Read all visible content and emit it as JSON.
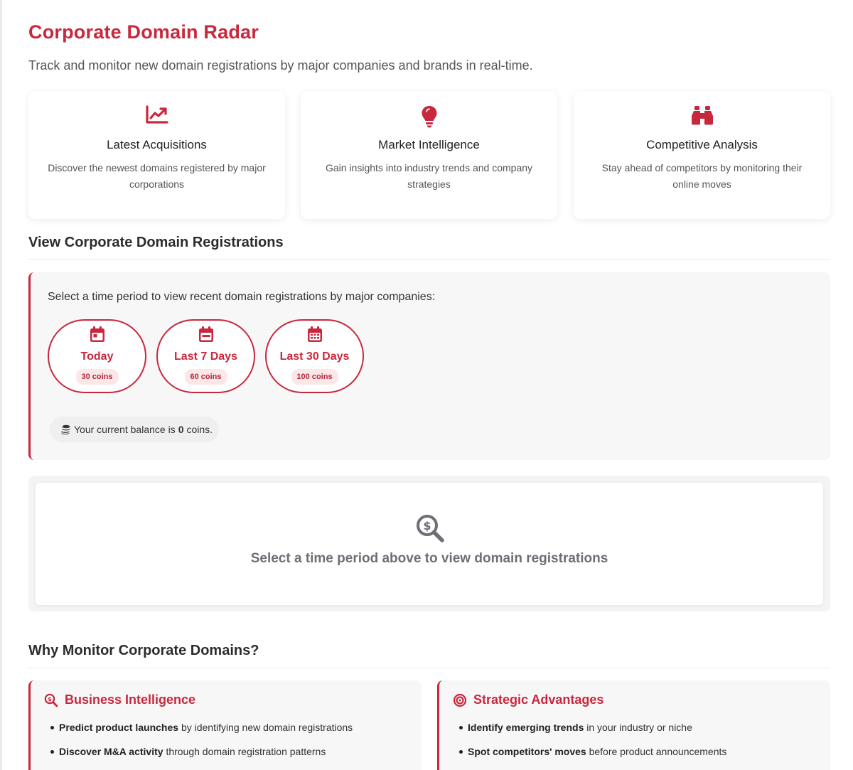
{
  "header": {
    "title": "Corporate Domain Radar",
    "subtitle": "Track and monitor new domain registrations by major companies and brands in real-time."
  },
  "features": [
    {
      "icon": "chart-line-icon",
      "title": "Latest Acquisitions",
      "description": "Discover the newest domains registered by major corporations"
    },
    {
      "icon": "lightbulb-icon",
      "title": "Market Intelligence",
      "description": "Gain insights into industry trends and company strategies"
    },
    {
      "icon": "binoculars-icon",
      "title": "Competitive Analysis",
      "description": "Stay ahead of competitors by monitoring their online moves"
    }
  ],
  "view_section": {
    "heading": "View Corporate Domain Registrations",
    "prompt": "Select a time period to view recent domain registrations by major companies:",
    "periods": [
      {
        "label": "Today",
        "cost": "30 coins",
        "icon": "calendar-day-icon"
      },
      {
        "label": "Last 7 Days",
        "cost": "60 coins",
        "icon": "calendar-week-icon"
      },
      {
        "label": "Last 30 Days",
        "cost": "100 coins",
        "icon": "calendar-month-icon"
      }
    ],
    "balance": {
      "prefix": "Your current balance is",
      "amount": "0",
      "suffix": "coins.",
      "icon": "coins-icon"
    }
  },
  "results": {
    "icon": "search-dollar-icon",
    "empty_message": "Select a time period above to view domain registrations"
  },
  "why_section": {
    "heading": "Why Monitor Corporate Domains?",
    "cards": [
      {
        "icon": "search-icon",
        "title": "Business Intelligence",
        "items": [
          {
            "bold": "Predict product launches",
            "rest": "by identifying new domain registrations"
          },
          {
            "bold": "Discover M&A activity",
            "rest": "through domain registration patterns"
          }
        ]
      },
      {
        "icon": "bullseye-icon",
        "title": "Strategic Advantages",
        "items": [
          {
            "bold": "Identify emerging trends",
            "rest": "in your industry or niche"
          },
          {
            "bold": "Spot competitors' moves",
            "rest": "before product announcements"
          }
        ]
      }
    ]
  },
  "colors": {
    "accent": "#c8283d",
    "cost_badge_bg": "#fbe6e8",
    "panel_bg": "#f7f7f7",
    "muted_text": "#6c6f75"
  }
}
